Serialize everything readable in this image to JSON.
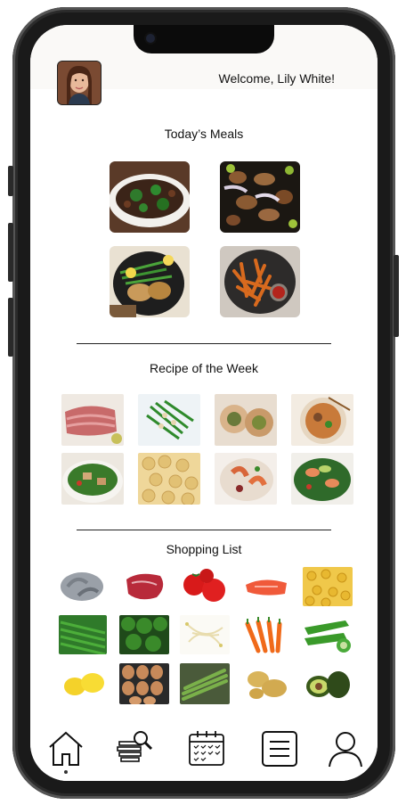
{
  "header": {
    "welcome_text": "Welcome, Lily White!",
    "avatar_icon": "user-photo"
  },
  "sections": {
    "todays_meals": {
      "title": "Today’s Meals",
      "items": [
        "beef-broccoli",
        "mushroom-onion-stirfry",
        "chicken-green-beans",
        "sweet-potato-fries"
      ]
    },
    "recipe_of_week": {
      "title": "Recipe of the Week",
      "items": [
        "sliced-ham",
        "green-beans-almonds",
        "stuffed-pork-roll",
        "pho-soup",
        "chicken-salad",
        "macaroni",
        "shrimp-dish",
        "salmon-avocado-salad"
      ]
    },
    "shopping_list": {
      "title": "Shopping List",
      "items": [
        "shrimp",
        "beef-steak",
        "tomatoes",
        "salmon-fillet",
        "macaroni",
        "green-beans",
        "broccoli",
        "bean-sprouts",
        "carrots",
        "okra",
        "lemons",
        "eggs",
        "asparagus",
        "potatoes",
        "avocados"
      ]
    }
  },
  "nav": {
    "items": [
      "home-icon",
      "recipes-search-icon",
      "calendar-icon",
      "menu-list-icon",
      "profile-icon"
    ],
    "active": "home-icon"
  },
  "colors": {
    "header_bg": "#faf9f7",
    "frame": "#1a1a1a",
    "text": "#111111"
  }
}
